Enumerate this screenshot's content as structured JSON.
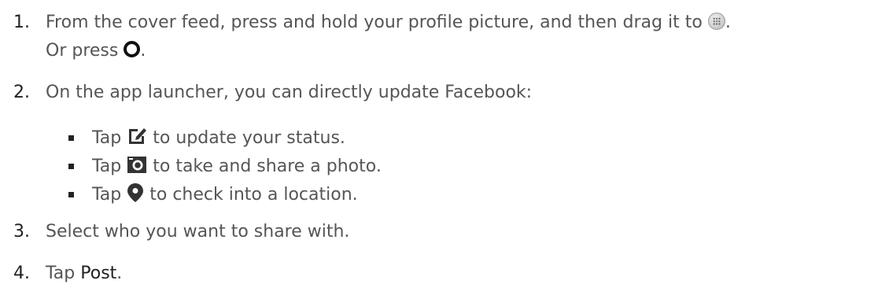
{
  "steps": [
    {
      "number": "1.",
      "text_a": "From the cover feed, press and hold your profile picture, and then drag it to",
      "text_b": ".",
      "text_c": "Or press",
      "text_d": ".",
      "icons": [
        "apps-home-icon",
        "home-ring-icon"
      ]
    },
    {
      "number": "2.",
      "text": "On the app launcher, you can directly update Facebook:",
      "bullets": [
        {
          "prefix": "Tap",
          "icon": "edit-status-icon",
          "suffix": "to update your status."
        },
        {
          "prefix": "Tap",
          "icon": "camera-icon",
          "suffix": "to take and share a photo."
        },
        {
          "prefix": "Tap",
          "icon": "location-pin-icon",
          "suffix": "to check into a location."
        }
      ]
    },
    {
      "number": "3.",
      "text": "Select who you want to share with."
    },
    {
      "number": "4.",
      "text_a": "Tap",
      "bold": "Post",
      "text_b": "."
    }
  ],
  "colors": {
    "text": "#555555",
    "numbers": "#222222",
    "icons": "#333333"
  }
}
